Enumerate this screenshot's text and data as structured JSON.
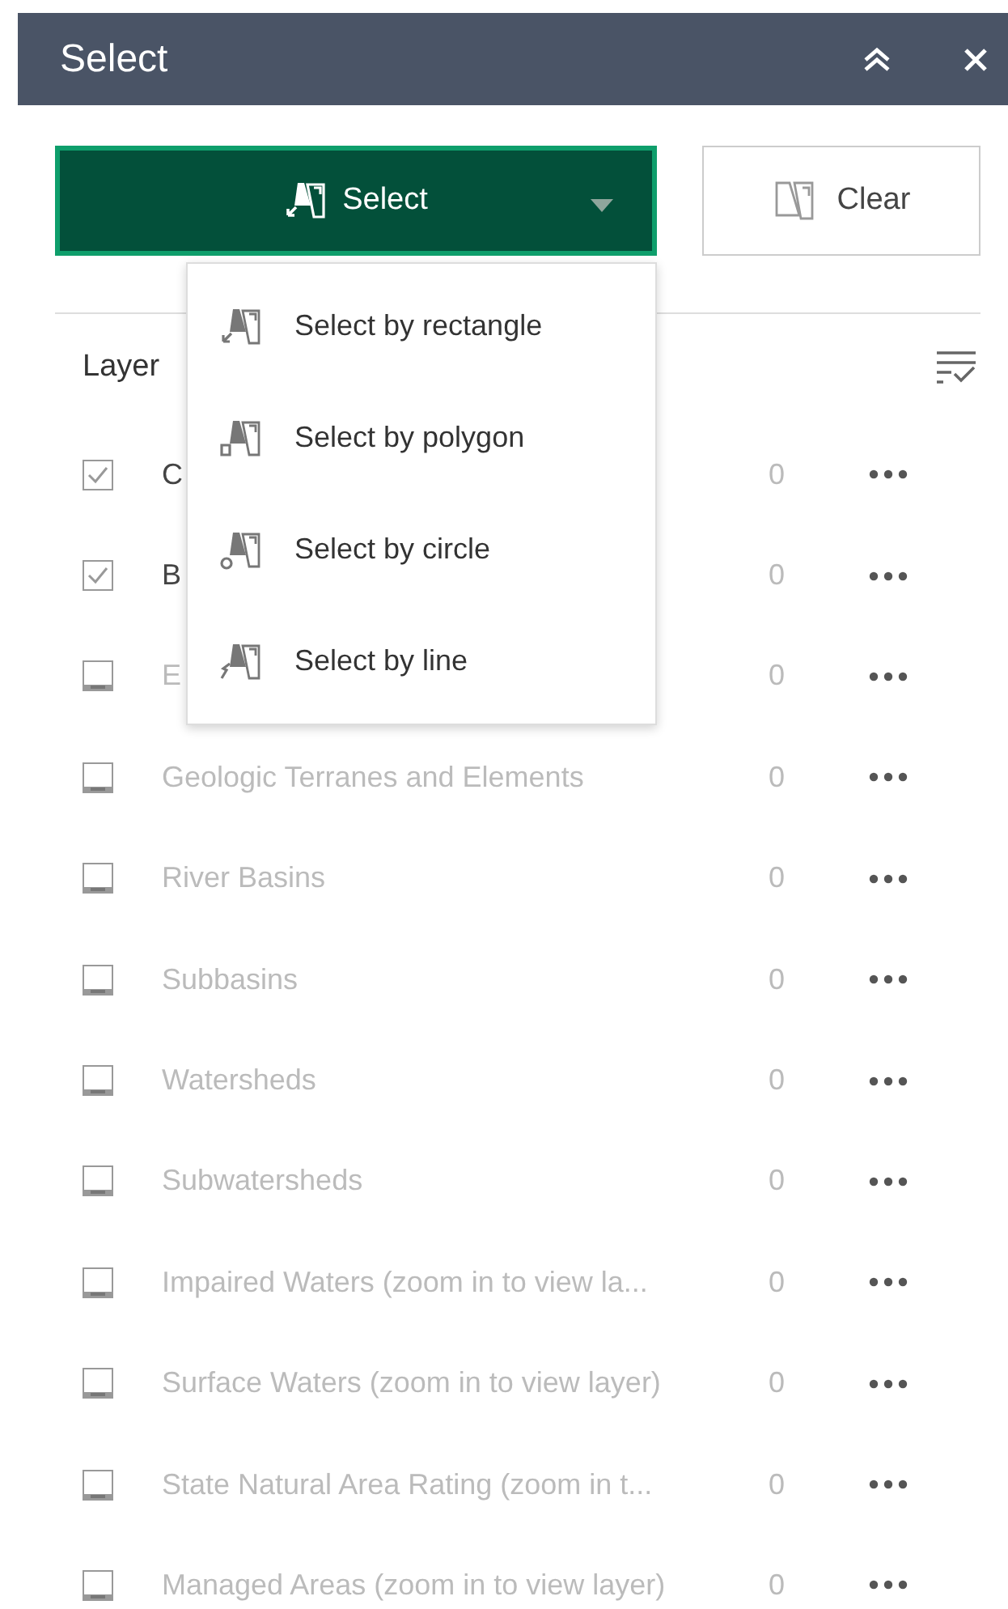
{
  "panel": {
    "title": "Select"
  },
  "select_button": {
    "label": "Select",
    "expanded": true
  },
  "clear_button": {
    "label": "Clear"
  },
  "menu": [
    {
      "label": "Select by rectangle",
      "kind": "rectangle"
    },
    {
      "label": "Select by polygon",
      "kind": "polygon"
    },
    {
      "label": "Select by circle",
      "kind": "circle"
    },
    {
      "label": "Select by line",
      "kind": "line"
    }
  ],
  "layers_header": {
    "label": "Layer"
  },
  "layers": [
    {
      "name": "C",
      "checked": true,
      "count": "0"
    },
    {
      "name": "B",
      "checked": true,
      "count": "0"
    },
    {
      "name": "E",
      "checked": false,
      "count": "0"
    },
    {
      "name": "Geologic Terranes and Elements",
      "checked": false,
      "count": "0"
    },
    {
      "name": "River Basins",
      "checked": false,
      "count": "0"
    },
    {
      "name": "Subbasins",
      "checked": false,
      "count": "0"
    },
    {
      "name": "Watersheds",
      "checked": false,
      "count": "0"
    },
    {
      "name": "Subwatersheds",
      "checked": false,
      "count": "0"
    },
    {
      "name": "Impaired Waters (zoom in to view la...",
      "checked": false,
      "count": "0"
    },
    {
      "name": "Surface Waters (zoom in to view layer)",
      "checked": false,
      "count": "0"
    },
    {
      "name": "State Natural Area Rating (zoom in t...",
      "checked": false,
      "count": "0"
    },
    {
      "name": "Managed Areas (zoom in to view layer)",
      "checked": false,
      "count": "0"
    }
  ]
}
